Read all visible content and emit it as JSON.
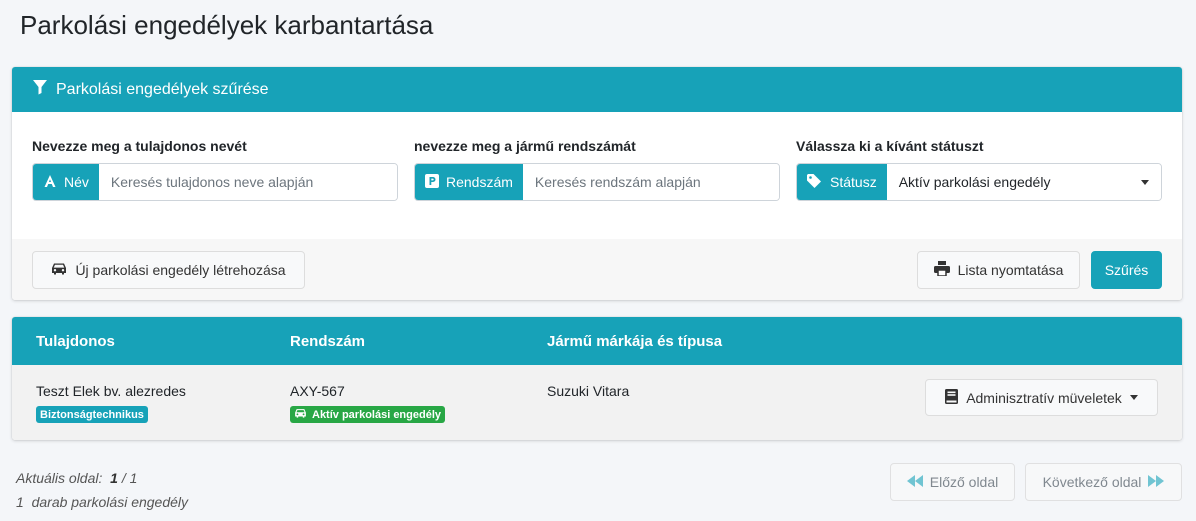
{
  "page": {
    "title": "Parkolási engedélyek karbantartása"
  },
  "filter": {
    "header": "Parkolási engedélyek szűrése",
    "name": {
      "label": "Nevezze meg a tulajdonos nevét",
      "addon": "Név",
      "placeholder": "Keresés tulajdonos neve alapján"
    },
    "plate": {
      "label": "nevezze meg a jármű rendszámát",
      "addon": "Rendszám",
      "placeholder": "Keresés rendszám alapján"
    },
    "status": {
      "label": "Válassza ki a kívánt státuszt",
      "addon": "Státusz",
      "selected": "Aktív parkolási engedély"
    },
    "new_button": "Új parkolási engedély létrehozása",
    "print_button": "Lista nyomtatása",
    "filter_button": "Szűrés"
  },
  "table": {
    "headers": [
      "Tulajdonos",
      "Rendszám",
      "Jármű márkája és típusa"
    ],
    "rows": [
      {
        "owner": "Teszt Elek bv. alezredes",
        "owner_badge": "Biztonságtechnikus",
        "plate": "AXY-567",
        "status_badge": "Aktív parkolási engedély",
        "vehicle": "Suzuki Vitara",
        "actions": "Adminisztratív müveletek"
      }
    ]
  },
  "pager": {
    "current_label": "Aktuális oldal:",
    "current_page": "1",
    "separator": "/",
    "total_pages": "1",
    "count": "1",
    "count_label": "darab parkolási engedély",
    "prev": "Előző oldal",
    "next": "Következő oldal"
  },
  "colors": {
    "accent": "#17a2b8",
    "success": "#28a745"
  }
}
